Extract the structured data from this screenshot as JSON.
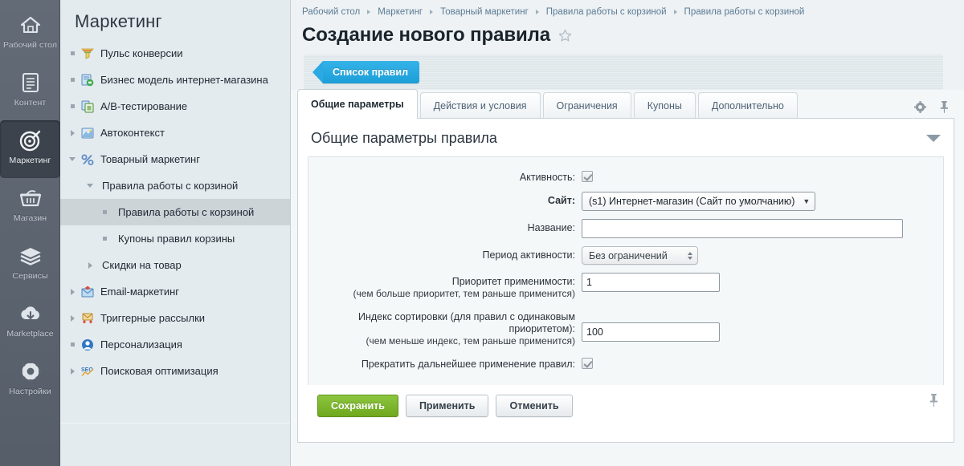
{
  "rail": {
    "items": [
      {
        "label": "Рабочий стол",
        "icon": "home-icon",
        "active": false
      },
      {
        "label": "Контент",
        "icon": "document-icon",
        "active": false
      },
      {
        "label": "Маркетинг",
        "icon": "target-icon",
        "active": true
      },
      {
        "label": "Магазин",
        "icon": "basket-icon",
        "active": false
      },
      {
        "label": "Сервисы",
        "icon": "layers-icon",
        "active": false
      },
      {
        "label": "Marketplace",
        "icon": "cloud-download-icon",
        "active": false
      },
      {
        "label": "Настройки",
        "icon": "gear-icon",
        "active": false
      }
    ]
  },
  "tree": {
    "title": "Маркетинг",
    "items": [
      {
        "label": "Пульс конверсии",
        "indent": 0,
        "marker": "leaf",
        "icon": "funnel-icon",
        "selected": false
      },
      {
        "label": "Бизнес модель интернет-магазина",
        "indent": 0,
        "marker": "leaf",
        "icon": "business-model-icon",
        "selected": false
      },
      {
        "label": "A/B-тестирование",
        "indent": 0,
        "marker": "leaf",
        "icon": "ab-test-icon",
        "selected": false
      },
      {
        "label": "Автоконтекст",
        "indent": 0,
        "marker": "collapsed",
        "icon": "chart-image-icon",
        "selected": false
      },
      {
        "label": "Товарный маркетинг",
        "indent": 0,
        "marker": "expanded",
        "icon": "percent-icon",
        "selected": false
      },
      {
        "label": "Правила работы с корзиной",
        "indent": 1,
        "marker": "expanded",
        "icon": "none",
        "selected": false
      },
      {
        "label": "Правила работы с корзиной",
        "indent": 2,
        "marker": "leaf",
        "icon": "none",
        "selected": true
      },
      {
        "label": "Купоны правил корзины",
        "indent": 2,
        "marker": "leaf",
        "icon": "none",
        "selected": false
      },
      {
        "label": "Скидки на товар",
        "indent": 1,
        "marker": "collapsed",
        "icon": "none",
        "selected": false
      },
      {
        "label": "Email-маркетинг",
        "indent": 0,
        "marker": "collapsed",
        "icon": "email-icon",
        "selected": false
      },
      {
        "label": "Триггерные рассылки",
        "indent": 0,
        "marker": "collapsed",
        "icon": "trigger-mail-icon",
        "selected": false
      },
      {
        "label": "Персонализация",
        "indent": 0,
        "marker": "leaf",
        "icon": "person-icon",
        "selected": false
      },
      {
        "label": "Поисковая оптимизация",
        "indent": 0,
        "marker": "collapsed",
        "icon": "seo-icon",
        "selected": false
      }
    ]
  },
  "breadcrumb": [
    "Рабочий стол",
    "Маркетинг",
    "Товарный маркетинг",
    "Правила работы с корзиной",
    "Правила работы с корзиной"
  ],
  "header": {
    "title": "Создание нового правила",
    "favorite_icon": "star-icon"
  },
  "toolbar": {
    "back_label": "Список правил"
  },
  "tabs": [
    {
      "label": "Общие параметры",
      "active": true
    },
    {
      "label": "Действия и условия",
      "active": false
    },
    {
      "label": "Ограничения",
      "active": false
    },
    {
      "label": "Купоны",
      "active": false
    },
    {
      "label": "Дополнительно",
      "active": false
    }
  ],
  "tab_actions": [
    {
      "icon": "gear-icon"
    },
    {
      "icon": "pin-icon"
    }
  ],
  "section": {
    "title": "Общие параметры правила",
    "collapse_icon": "chevron-down-icon"
  },
  "form": {
    "activity": {
      "label": "Активность:",
      "checked": true
    },
    "site": {
      "label": "Сайт:",
      "value": "(s1) Интернет-магазин (Сайт по умолчанию)",
      "caret": "▼"
    },
    "name": {
      "label": "Название:",
      "value": "",
      "placeholder": ""
    },
    "period": {
      "label": "Период активности:",
      "value": "Без ограничений"
    },
    "priority": {
      "label": "Приоритет применимости:",
      "hint": "(чем больше приоритет, тем раньше применится)",
      "value": "1"
    },
    "sort_index": {
      "label": "Индекс сортировки (для правил с одинаковым приоритетом):",
      "hint": "(чем меньше индекс, тем раньше применится)",
      "value": "100"
    },
    "stop_further": {
      "label": "Прекратить дальнейшее применение правил:",
      "checked": true
    }
  },
  "buttons": {
    "save": "Сохранить",
    "apply": "Применить",
    "cancel": "Отменить"
  },
  "footer": {
    "pin_icon": "pin-icon"
  },
  "colors": {
    "accent_blue": "#1c9ed8",
    "primary_green": "#6fa81e",
    "rail_bg": "#5c6470",
    "tree_bg": "#e4ebee",
    "selected_tree": "#ccd4d8"
  }
}
